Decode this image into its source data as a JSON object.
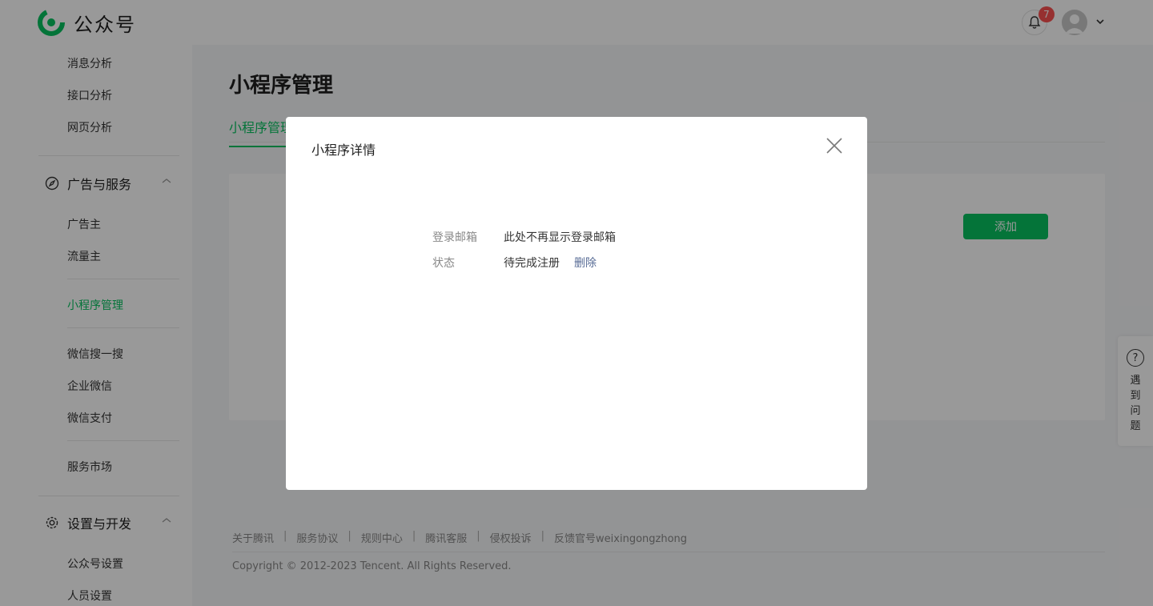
{
  "header": {
    "brand": "公众号",
    "notification_count": "7",
    "colors": {
      "brand": "#07c160",
      "badge": "#fa5151"
    }
  },
  "sidebar": {
    "items_top": [
      "消息分析",
      "接口分析",
      "网页分析"
    ],
    "section_ads": "广告与服务",
    "items_ads": [
      "广告主",
      "流量主"
    ],
    "item_active": "小程序管理",
    "items_more": [
      "微信搜一搜",
      "企业微信",
      "微信支付"
    ],
    "item_market": "服务市场",
    "section_settings": "设置与开发",
    "items_settings": [
      "公众号设置",
      "人员设置"
    ]
  },
  "main": {
    "title": "小程序管理",
    "tab_active": "小程序管理",
    "add_button": "添加"
  },
  "dialog": {
    "title": "小程序详情",
    "rows": [
      {
        "label": "登录邮箱",
        "value": "此处不再显示登录邮箱"
      },
      {
        "label": "状态",
        "value": "待完成注册",
        "link": "删除"
      }
    ]
  },
  "footer": {
    "links": [
      "关于腾讯",
      "服务协议",
      "规则中心",
      "腾讯客服",
      "侵权投诉",
      "反馈官号weixingongzhong"
    ],
    "copyright": "Copyright © 2012-2023 Tencent. All Rights Reserved."
  },
  "help": {
    "label": "遇到问题"
  }
}
